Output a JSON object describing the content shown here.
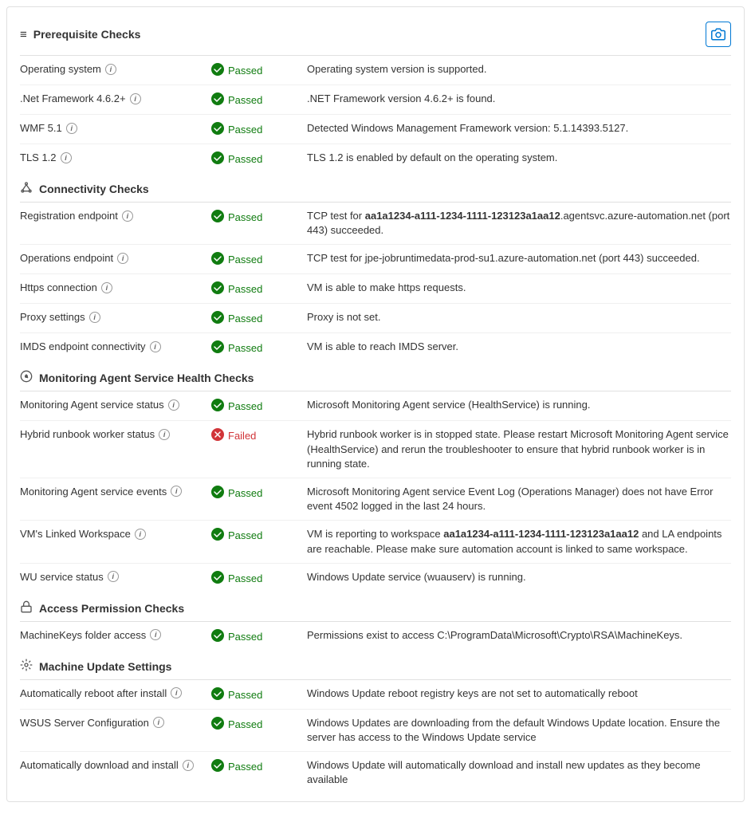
{
  "title": "Prerequisite Checks",
  "camera_button_label": "📷",
  "sections": [
    {
      "id": "prerequisite",
      "icon": "≡",
      "title": "Prerequisite Checks",
      "is_top": true,
      "checks": [
        {
          "name": "Operating system",
          "has_info": true,
          "status": "Passed",
          "status_type": "passed",
          "description": "Operating system version is supported."
        },
        {
          "name": ".Net Framework 4.6.2+",
          "has_info": true,
          "status": "Passed",
          "status_type": "passed",
          "description": ".NET Framework version 4.6.2+ is found."
        },
        {
          "name": "WMF 5.1",
          "has_info": true,
          "status": "Passed",
          "status_type": "passed",
          "description": "Detected Windows Management Framework version: 5.1.14393.5127."
        },
        {
          "name": "TLS 1.2",
          "has_info": true,
          "status": "Passed",
          "status_type": "passed",
          "description": "TLS 1.2 is enabled by default on the operating system."
        }
      ]
    },
    {
      "id": "connectivity",
      "icon": "🔗",
      "title": "Connectivity Checks",
      "is_top": false,
      "checks": [
        {
          "name": "Registration endpoint",
          "has_info": true,
          "status": "Passed",
          "status_type": "passed",
          "description": "TCP test for aa1a1234-a111-1234-1111-123123a1aa12.agentsvc.azure-automation.net (port 443) succeeded.",
          "highlight_part": "aa1a1234-a111-1234-1111-123123a1aa12"
        },
        {
          "name": "Operations endpoint",
          "has_info": true,
          "status": "Passed",
          "status_type": "passed",
          "description": "TCP test for jpe-jobruntimedata-prod-su1.azure-automation.net (port 443) succeeded."
        },
        {
          "name": "Https connection",
          "has_info": true,
          "status": "Passed",
          "status_type": "passed",
          "description": "VM is able to make https requests."
        },
        {
          "name": "Proxy settings",
          "has_info": true,
          "status": "Passed",
          "status_type": "passed",
          "description": "Proxy is not set."
        },
        {
          "name": "IMDS endpoint connectivity",
          "has_info": true,
          "status": "Passed",
          "status_type": "passed",
          "description": "VM is able to reach IMDS server."
        }
      ]
    },
    {
      "id": "monitoring",
      "icon": "⚙",
      "title": "Monitoring Agent Service Health Checks",
      "is_top": false,
      "checks": [
        {
          "name": "Monitoring Agent service status",
          "has_info": true,
          "status": "Passed",
          "status_type": "passed",
          "description": "Microsoft Monitoring Agent service (HealthService) is running."
        },
        {
          "name": "Hybrid runbook worker status",
          "has_info": true,
          "status": "Failed",
          "status_type": "failed",
          "description": "Hybrid runbook worker is in stopped state. Please restart Microsoft Monitoring Agent service (HealthService) and rerun the troubleshooter to ensure that hybrid runbook worker is in running state."
        },
        {
          "name": "Monitoring Agent service events",
          "has_info": true,
          "status": "Passed",
          "status_type": "passed",
          "description": "Microsoft Monitoring Agent service Event Log (Operations Manager) does not have Error event 4502 logged in the last 24 hours."
        },
        {
          "name": "VM's Linked Workspace",
          "has_info": true,
          "status": "Passed",
          "status_type": "passed",
          "description": "VM is reporting to workspace aa1a1234-a111-1234-1111-123123a1aa12 and LA endpoints are reachable. Please make sure automation account is linked to same workspace.",
          "highlight_part": "aa1a1234-a111-1234-1111-123123a1aa12"
        },
        {
          "name": "WU service status",
          "has_info": true,
          "status": "Passed",
          "status_type": "passed",
          "description": "Windows Update service (wuauserv) is running."
        }
      ]
    },
    {
      "id": "access",
      "icon": "🔒",
      "title": "Access Permission Checks",
      "is_top": false,
      "checks": [
        {
          "name": "MachineKeys folder access",
          "has_info": true,
          "status": "Passed",
          "status_type": "passed",
          "description": "Permissions exist to access C:\\ProgramData\\Microsoft\\Crypto\\RSA\\MachineKeys."
        }
      ]
    },
    {
      "id": "machine_update",
      "icon": "⚙",
      "title": "Machine Update Settings",
      "is_top": false,
      "checks": [
        {
          "name": "Automatically reboot after install",
          "has_info": true,
          "status": "Passed",
          "status_type": "passed",
          "description": "Windows Update reboot registry keys are not set to automatically reboot"
        },
        {
          "name": "WSUS Server Configuration",
          "has_info": true,
          "status": "Passed",
          "status_type": "passed",
          "description": "Windows Updates are downloading from the default Windows Update location. Ensure the server has access to the Windows Update service"
        },
        {
          "name": "Automatically download and install",
          "has_info": true,
          "status": "Passed",
          "status_type": "passed",
          "description": "Windows Update will automatically download and install new updates as they become available"
        }
      ]
    }
  ]
}
